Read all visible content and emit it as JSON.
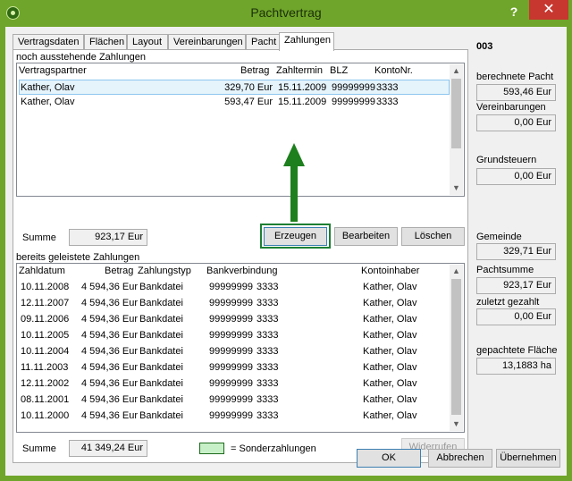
{
  "window": {
    "title": "Pachtvertrag",
    "help": "?",
    "close": "✕"
  },
  "tabs": [
    "Vertragsdaten",
    "Flächen",
    "Layout",
    "Vereinbarungen",
    "Pacht",
    "Zahlungen"
  ],
  "pending": {
    "label": "noch ausstehende Zahlungen",
    "headers": {
      "partner": "Vertragspartner",
      "amount": "Betrag",
      "date": "Zahltermin",
      "blz": "BLZ",
      "konto": "KontoNr."
    },
    "rows": [
      {
        "partner": "Kather, Olav",
        "amount": "329,70 Eur",
        "date": "15.11.2009",
        "blz": "99999999",
        "konto": "3333"
      },
      {
        "partner": "Kather, Olav",
        "amount": "593,47 Eur",
        "date": "15.11.2009",
        "blz": "99999999",
        "konto": "3333"
      }
    ],
    "sum_label": "Summe",
    "sum_value": "923,17 Eur",
    "buttons": {
      "create": "Erzeugen",
      "edit": "Bearbeiten",
      "delete": "Löschen"
    }
  },
  "paid": {
    "label": "bereits geleistete Zahlungen",
    "headers": {
      "date": "Zahldatum",
      "amount": "Betrag",
      "type": "Zahlungstyp",
      "bank": "Bankverbindung",
      "holder": "Kontoinhaber"
    },
    "rows": [
      {
        "date": "10.11.2008",
        "amount": "4 594,36 Eur",
        "type": "Bankdatei",
        "blz": "99999999",
        "konto": "3333",
        "holder": "Kather, Olav"
      },
      {
        "date": "12.11.2007",
        "amount": "4 594,36 Eur",
        "type": "Bankdatei",
        "blz": "99999999",
        "konto": "3333",
        "holder": "Kather, Olav"
      },
      {
        "date": "09.11.2006",
        "amount": "4 594,36 Eur",
        "type": "Bankdatei",
        "blz": "99999999",
        "konto": "3333",
        "holder": "Kather, Olav"
      },
      {
        "date": "10.11.2005",
        "amount": "4 594,36 Eur",
        "type": "Bankdatei",
        "blz": "99999999",
        "konto": "3333",
        "holder": "Kather, Olav"
      },
      {
        "date": "10.11.2004",
        "amount": "4 594,36 Eur",
        "type": "Bankdatei",
        "blz": "99999999",
        "konto": "3333",
        "holder": "Kather, Olav"
      },
      {
        "date": "11.11.2003",
        "amount": "4 594,36 Eur",
        "type": "Bankdatei",
        "blz": "99999999",
        "konto": "3333",
        "holder": "Kather, Olav"
      },
      {
        "date": "12.11.2002",
        "amount": "4 594,36 Eur",
        "type": "Bankdatei",
        "blz": "99999999",
        "konto": "3333",
        "holder": "Kather, Olav"
      },
      {
        "date": "08.11.2001",
        "amount": "4 594,36 Eur",
        "type": "Bankdatei",
        "blz": "99999999",
        "konto": "3333",
        "holder": "Kather, Olav"
      },
      {
        "date": "10.11.2000",
        "amount": "4 594,36 Eur",
        "type": "Bankdatei",
        "blz": "99999999",
        "konto": "3333",
        "holder": "Kather, Olav"
      }
    ],
    "sum_label": "Summe",
    "sum_value": "41 349,24 Eur",
    "legend": "= Sonderzahlungen",
    "legend_color": "#c8f0c8",
    "revoke": "Widerrufen"
  },
  "side": {
    "id": "003",
    "calc_rent_label": "berechnete Pacht",
    "calc_rent": "593,46 Eur",
    "agreements_label": "Vereinbarungen",
    "agreements": "0,00 Eur",
    "land_tax_label": "Grundsteuern",
    "land_tax": "0,00 Eur",
    "municipality_label": "Gemeinde",
    "municipality": "329,71 Eur",
    "rent_total_label": "Pachtsumme",
    "rent_total": "923,17 Eur",
    "overpaid_label": "zuletzt gezahlt",
    "overpaid": "0,00 Eur",
    "area_label": "gepachtete Fläche",
    "area": "13,1883 ha"
  },
  "footer": {
    "ok": "OK",
    "cancel": "Abbrechen",
    "apply": "Übernehmen"
  },
  "colors": {
    "titlebar": "#6fa52a",
    "close": "#c7372f",
    "arrow": "#1d7f1d",
    "selection": "#e5f3fb"
  }
}
